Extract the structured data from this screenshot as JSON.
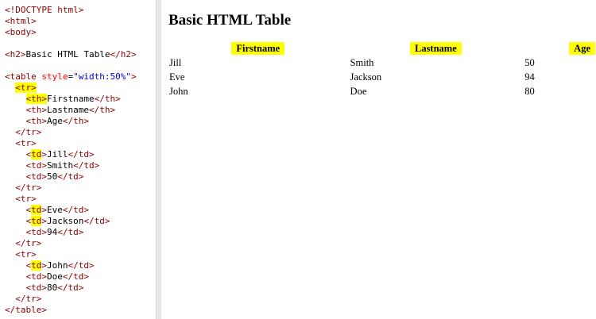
{
  "code": {
    "lines": [
      {
        "parts": [
          {
            "t": "<!DOCTYPE html>",
            "c": "tk"
          }
        ]
      },
      {
        "parts": [
          {
            "t": "<html>",
            "c": "tk"
          }
        ]
      },
      {
        "parts": [
          {
            "t": "<body>",
            "c": "tk"
          }
        ]
      },
      {
        "parts": []
      },
      {
        "parts": [
          {
            "t": "<h2>",
            "c": "tk"
          },
          {
            "t": "Basic HTML Table",
            "c": "tx"
          },
          {
            "t": "</h2>",
            "c": "tk"
          }
        ]
      },
      {
        "parts": []
      },
      {
        "parts": [
          {
            "t": "<table ",
            "c": "tk"
          },
          {
            "t": "style",
            "c": "at"
          },
          {
            "t": "=",
            "c": "tx"
          },
          {
            "t": "\"width:50%\"",
            "c": "av"
          },
          {
            "t": ">",
            "c": "tk"
          }
        ]
      },
      {
        "parts": [
          {
            "t": "  ",
            "c": "tx"
          },
          {
            "t": "<tr>",
            "c": "tk",
            "hl": true
          }
        ]
      },
      {
        "parts": [
          {
            "t": "    ",
            "c": "tx"
          },
          {
            "t": "<th>",
            "c": "tk",
            "hl": true
          },
          {
            "t": "Firstname",
            "c": "tx"
          },
          {
            "t": "</th>",
            "c": "tk"
          }
        ]
      },
      {
        "parts": [
          {
            "t": "    ",
            "c": "tx"
          },
          {
            "t": "<th>",
            "c": "tk"
          },
          {
            "t": "Lastname",
            "c": "tx"
          },
          {
            "t": "</th>",
            "c": "tk"
          }
        ]
      },
      {
        "parts": [
          {
            "t": "    ",
            "c": "tx"
          },
          {
            "t": "<th>",
            "c": "tk"
          },
          {
            "t": "Age",
            "c": "tx"
          },
          {
            "t": "</th>",
            "c": "tk"
          }
        ]
      },
      {
        "parts": [
          {
            "t": "  ",
            "c": "tx"
          },
          {
            "t": "</tr>",
            "c": "tk"
          }
        ]
      },
      {
        "parts": [
          {
            "t": "  ",
            "c": "tx"
          },
          {
            "t": "<tr>",
            "c": "tk"
          }
        ]
      },
      {
        "parts": [
          {
            "t": "    ",
            "c": "tx"
          },
          {
            "t": "<",
            "c": "tk"
          },
          {
            "t": "td",
            "c": "tn",
            "hl": true
          },
          {
            "t": ">",
            "c": "tk"
          },
          {
            "t": "Jill",
            "c": "tx"
          },
          {
            "t": "</td>",
            "c": "tk"
          }
        ]
      },
      {
        "parts": [
          {
            "t": "    ",
            "c": "tx"
          },
          {
            "t": "<td>",
            "c": "tk"
          },
          {
            "t": "Smith",
            "c": "tx"
          },
          {
            "t": "</td>",
            "c": "tk"
          }
        ]
      },
      {
        "parts": [
          {
            "t": "    ",
            "c": "tx"
          },
          {
            "t": "<td>",
            "c": "tk"
          },
          {
            "t": "50",
            "c": "tx"
          },
          {
            "t": "</td>",
            "c": "tk"
          }
        ]
      },
      {
        "parts": [
          {
            "t": "  ",
            "c": "tx"
          },
          {
            "t": "</tr>",
            "c": "tk"
          }
        ]
      },
      {
        "parts": [
          {
            "t": "  ",
            "c": "tx"
          },
          {
            "t": "<tr>",
            "c": "tk"
          }
        ]
      },
      {
        "parts": [
          {
            "t": "    ",
            "c": "tx"
          },
          {
            "t": "<",
            "c": "tk"
          },
          {
            "t": "td",
            "c": "tn",
            "hl": true
          },
          {
            "t": ">",
            "c": "tk"
          },
          {
            "t": "Eve",
            "c": "tx"
          },
          {
            "t": "</td>",
            "c": "tk"
          }
        ]
      },
      {
        "parts": [
          {
            "t": "    ",
            "c": "tx"
          },
          {
            "t": "<",
            "c": "tk"
          },
          {
            "t": "td",
            "c": "tn",
            "hl": true
          },
          {
            "t": ">",
            "c": "tk"
          },
          {
            "t": "Jackson",
            "c": "tx"
          },
          {
            "t": "</td>",
            "c": "tk"
          }
        ]
      },
      {
        "parts": [
          {
            "t": "    ",
            "c": "tx"
          },
          {
            "t": "<td>",
            "c": "tk"
          },
          {
            "t": "94",
            "c": "tx"
          },
          {
            "t": "</td>",
            "c": "tk"
          }
        ]
      },
      {
        "parts": [
          {
            "t": "  ",
            "c": "tx"
          },
          {
            "t": "</tr>",
            "c": "tk"
          }
        ]
      },
      {
        "parts": [
          {
            "t": "  ",
            "c": "tx"
          },
          {
            "t": "<tr>",
            "c": "tk"
          }
        ]
      },
      {
        "parts": [
          {
            "t": "    ",
            "c": "tx"
          },
          {
            "t": "<",
            "c": "tk"
          },
          {
            "t": "td",
            "c": "tn",
            "hl": true
          },
          {
            "t": ">",
            "c": "tk"
          },
          {
            "t": "John",
            "c": "tx"
          },
          {
            "t": "</td>",
            "c": "tk"
          }
        ]
      },
      {
        "parts": [
          {
            "t": "    ",
            "c": "tx"
          },
          {
            "t": "<td>",
            "c": "tk"
          },
          {
            "t": "Doe",
            "c": "tx"
          },
          {
            "t": "</td>",
            "c": "tk"
          }
        ]
      },
      {
        "parts": [
          {
            "t": "    ",
            "c": "tx"
          },
          {
            "t": "<td>",
            "c": "tk"
          },
          {
            "t": "80",
            "c": "tx"
          },
          {
            "t": "</td>",
            "c": "tk"
          }
        ]
      },
      {
        "parts": [
          {
            "t": "  ",
            "c": "tx"
          },
          {
            "t": "</tr>",
            "c": "tk"
          }
        ]
      },
      {
        "parts": [
          {
            "t": "</table>",
            "c": "tk"
          }
        ]
      }
    ]
  },
  "result": {
    "title": "Basic HTML Table",
    "headers": [
      "Firstname",
      "Lastname",
      "Age"
    ],
    "rows": [
      [
        "Jill",
        "Smith",
        "50"
      ],
      [
        "Eve",
        "Jackson",
        "94"
      ],
      [
        "John",
        "Doe",
        "80"
      ]
    ]
  },
  "colors": {
    "highlight": "#ffff00",
    "tag": "#8b0000",
    "attribute": "#ff0000",
    "attribute_value": "#0000cd"
  }
}
